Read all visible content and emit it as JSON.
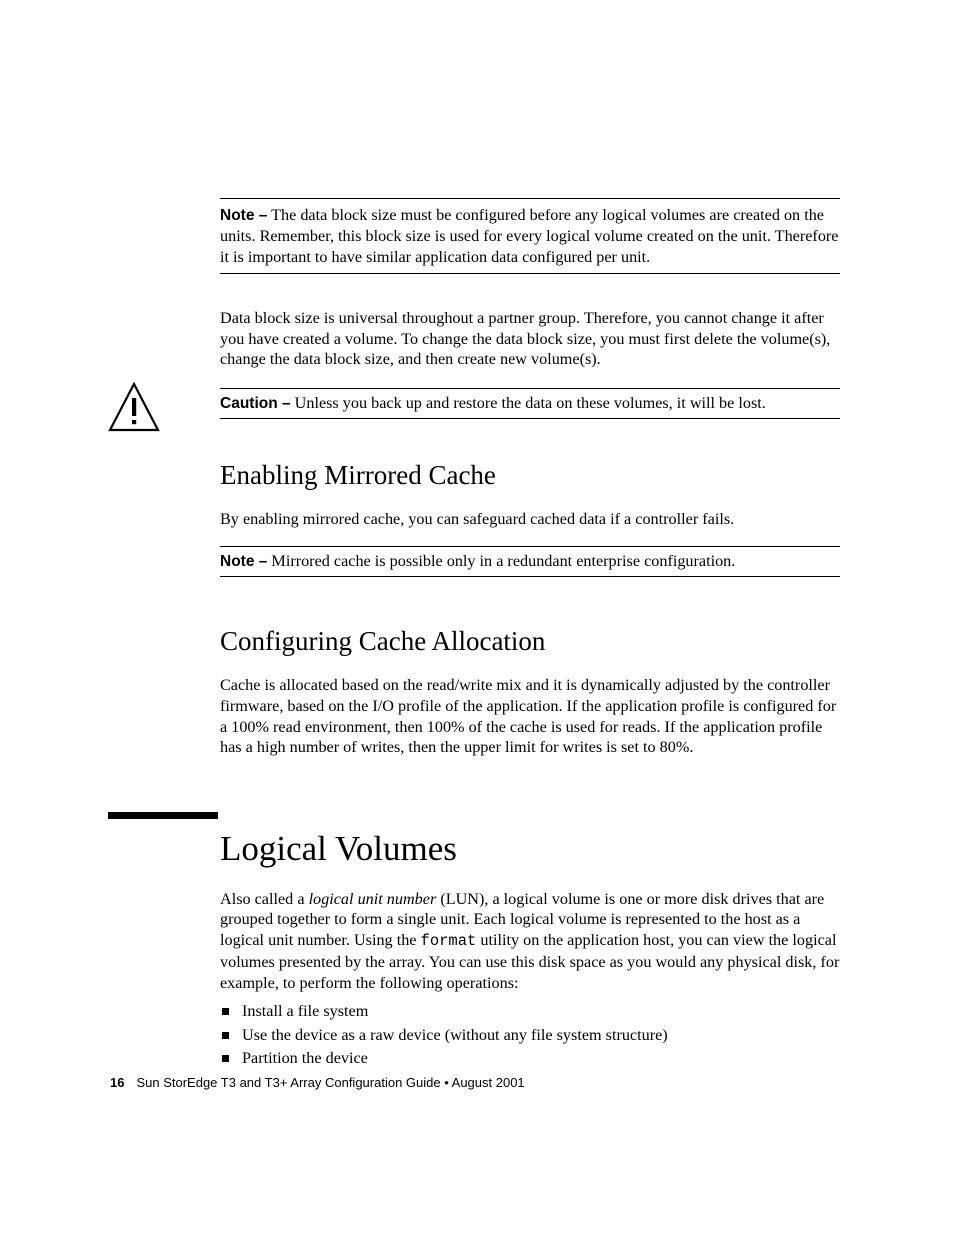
{
  "note1": {
    "label": "Note –",
    "text": " The data block size must be configured before any logical volumes are created on the units. Remember, this block size is used for every logical volume created on the unit. Therefore it is important to have similar application data configured per unit."
  },
  "para_block": "Data block size is universal throughout a partner group. Therefore, you cannot change it after you have created a volume. To change the data block size, you must first delete the volume(s), change the data block size, and then create new volume(s).",
  "caution": {
    "label": "Caution –",
    "text": " Unless you back up and restore the data on these volumes, it will be lost."
  },
  "sec_mirrored": {
    "title": "Enabling Mirrored Cache",
    "para": "By enabling mirrored cache, you can safeguard cached data if a controller fails.",
    "note_label": "Note –",
    "note_text": " Mirrored cache is possible only in a redundant enterprise configuration."
  },
  "sec_cache_alloc": {
    "title": "Configuring Cache Allocation",
    "para": "Cache is allocated based on the read/write mix and it is dynamically adjusted by the controller firmware, based on the I/O profile of the application. If the application profile is configured for a 100% read environment, then 100% of the cache is used for reads. If the application profile has a high number of writes, then the upper limit for writes is set to 80%."
  },
  "sec_logical": {
    "title": "Logical Volumes",
    "para_pre": "Also called a ",
    "para_italic": "logical unit number",
    "para_mid": " (LUN), a logical volume is one or more disk drives that are grouped together to form a single unit. Each logical volume is represented to the host as a logical unit number. Using the ",
    "para_mono": "format",
    "para_post": " utility on the application host, you can view the logical volumes presented by the array. You can use this disk space as you would any physical disk, for example, to perform the following operations:",
    "bullets": [
      "Install a file system",
      "Use the device as a raw device (without any file system structure)",
      "Partition the device"
    ]
  },
  "footer": {
    "page": "16",
    "text": "Sun StorEdge T3 and T3+ Array Configuration Guide • August 2001"
  }
}
